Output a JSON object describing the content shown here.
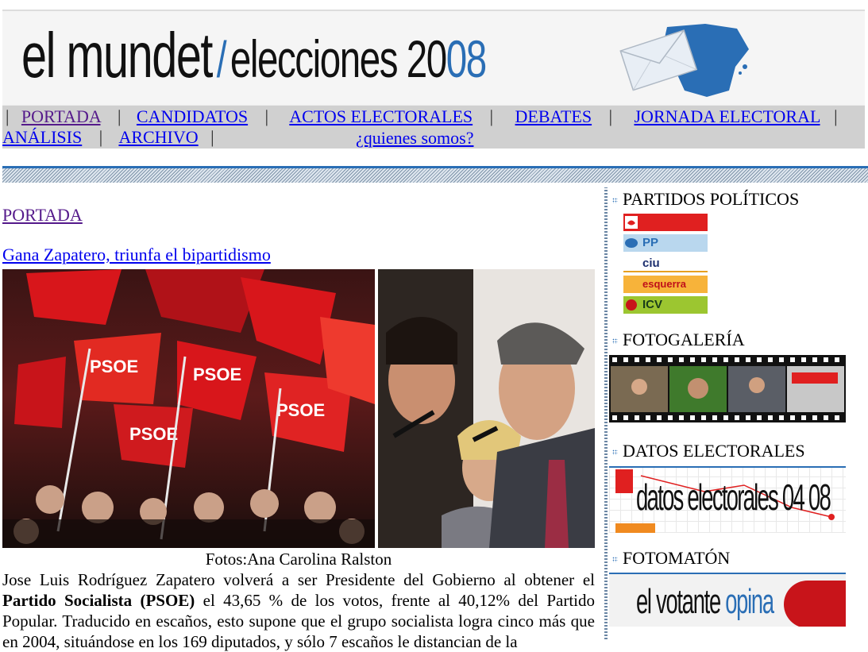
{
  "header": {
    "site": "el mundet",
    "slash": "/",
    "section": "elecciones 20",
    "section_accent": "08"
  },
  "nav": {
    "row1": [
      "PORTADA",
      "CANDIDATOS",
      "ACTOS ELECTORALES",
      "DEBATES",
      "JORNADA ELECTORAL"
    ],
    "row2": [
      "ANÁLISIS",
      "ARCHIVO"
    ],
    "about": "¿quienes somos?",
    "separator": "|"
  },
  "main": {
    "section_link": "PORTADA",
    "headline": "Gana Zapatero, triunfa el bipartidismo",
    "caption": "Fotos:Ana Carolina Ralston",
    "article": {
      "p1_a": "Jose Luis Rodríguez Zapatero volverá a ser Presidente del Gobierno al obtener el ",
      "p1_bold": "Partido Socialista (PSOE)",
      "p1_b": " el 43,65 % de los votos, frente al 40,12% del Partido Popular. Traducido en escaños, esto supone que el grupo socialista logra cinco más que en 2004, situándose en los 169 diputados, y sólo 7 escaños le distancian de la"
    }
  },
  "sidebar": {
    "partidos": {
      "title": "PARTIDOS POLÍTICOS",
      "parties": [
        {
          "label": "",
          "color": "#e02020",
          "icon": "psoe-logo"
        },
        {
          "label": "PP",
          "color": "#b9d7ee",
          "icon": "pp-logo"
        },
        {
          "label": "ciu",
          "color": "#ffffff",
          "icon": "ciu-logo"
        },
        {
          "label": "esquerra",
          "color": "#f7b33a",
          "icon": "erc-logo"
        },
        {
          "label": "ICV",
          "color": "#9cc630",
          "icon": "icv-logo"
        }
      ]
    },
    "fotogaleria": {
      "title": "FOTOGALERÍA"
    },
    "datos": {
      "title": "DATOS ELECTORALES",
      "banner_text": "datos electorales 04 08"
    },
    "fotomaton": {
      "title": "FOTOMATÓN",
      "banner_a": "el votante ",
      "banner_b": "opina"
    }
  },
  "colors": {
    "accent": "#2a6eb5",
    "nav_bg": "#d0d0d0",
    "link": "#0000ee",
    "visited": "#551a8b"
  }
}
